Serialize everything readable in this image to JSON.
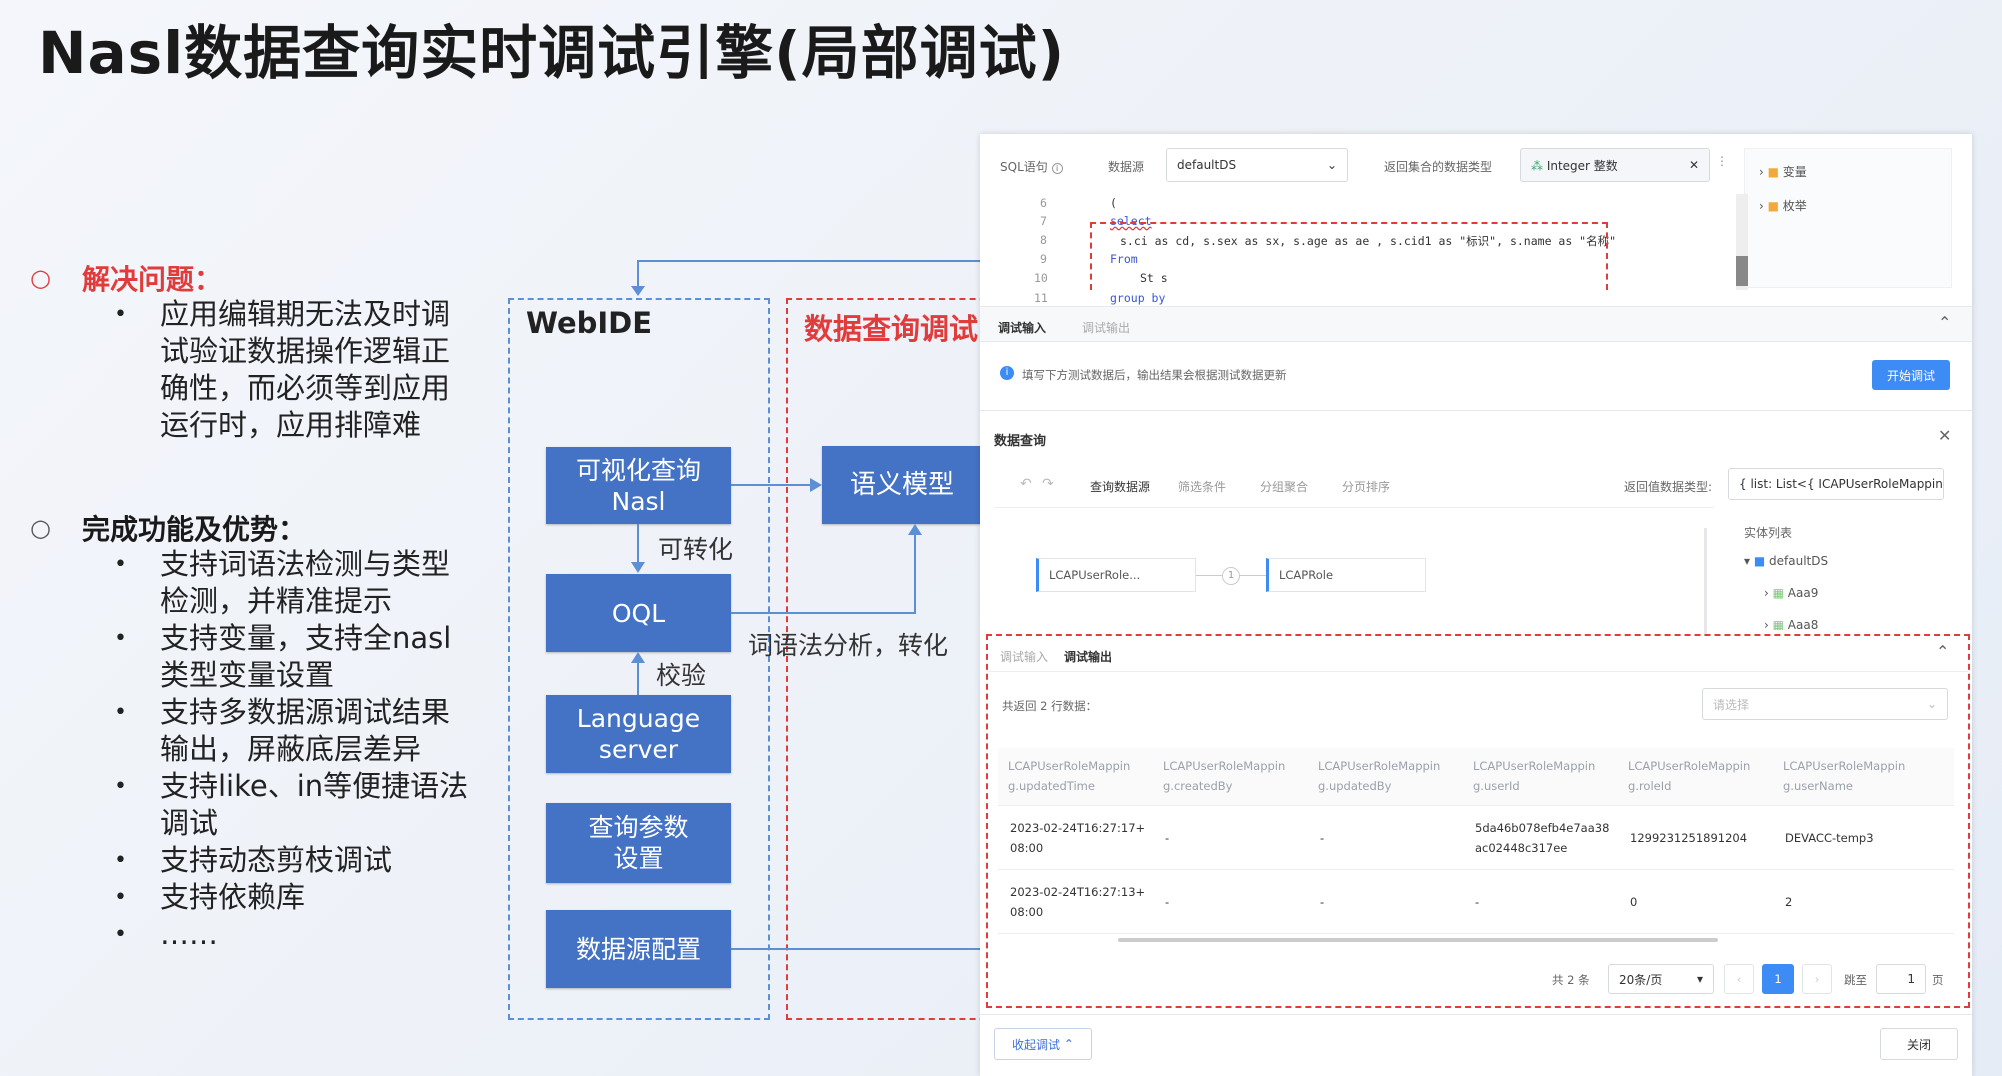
{
  "slide": {
    "title": "Nasl数据查询实时调试引擎(局部调试)",
    "section1": {
      "heading": "解决问题：",
      "bullet_icon": "○",
      "items": [
        "应用编辑期无法及时调试验证数据操作逻辑正确性，而必须等到应用运行时，应用排障难"
      ]
    },
    "section2": {
      "heading": "完成功能及优势：",
      "bullet_icon": "○",
      "items": [
        "支持词语法检测与类型检测，并精准提示",
        "支持变量，支持全nasl类型变量设置",
        "支持多数据源调试结果输出，屏蔽底层差异",
        "支持like、in等便捷语法调试",
        "支持动态剪枝调试",
        "支持依赖库",
        "……"
      ]
    },
    "colors": {
      "accent_red": "#e03c3c",
      "box_blue": "#4472c4",
      "dash_blue": "#5b8fd6"
    }
  },
  "diagram": {
    "webide_label": "WebIDE",
    "debug_label": "数据查询调试",
    "boxes": {
      "visual_query": [
        "可视化查询",
        "Nasl"
      ],
      "oql": "OQL",
      "language_server": [
        "Language",
        "server"
      ],
      "query_params": [
        "查询参数",
        "设置"
      ],
      "datasource_config": "数据源配置",
      "semantic_model": "语义模型"
    },
    "labels": {
      "convertible": "可转化",
      "verify": "校验",
      "lexical_analysis": "词语法分析，转化"
    }
  },
  "ui": {
    "sql_label": "SQL语句",
    "datasource_label": "数据源",
    "datasource_value": "defaultDS",
    "return_type_label": "返回集合的数据类型",
    "return_type_value": "Integer 整数",
    "tree": [
      {
        "label": "变量"
      },
      {
        "label": "枚举"
      }
    ],
    "code_lines": [
      {
        "n": "6",
        "text": "("
      },
      {
        "n": "7",
        "text": "select"
      },
      {
        "n": "8",
        "text": "s.ci as cd, s.sex as sx, s.age as ae , s.cid1 as \"标识\", s.name as \"名称\""
      },
      {
        "n": "9",
        "text": "From"
      },
      {
        "n": "10",
        "text": "St s"
      },
      {
        "n": "11",
        "text": "group by"
      }
    ],
    "top_tabs": [
      "调试输入",
      "调试输出"
    ],
    "info_text": "填写下方测试数据后，输出结果会根据测试数据更新",
    "start_debug": "开始调试",
    "data_query_title": "数据查询",
    "query_tabs": [
      "查询数据源",
      "筛选条件",
      "分组聚合",
      "分页排序"
    ],
    "return_value_type_label": "返回值数据类型:",
    "return_value_type_value": "{ list: List<{ ICAPUserRoleMapping:",
    "entity_list_label": "实体列表",
    "entity_tree": [
      "defaultDS",
      "Aaa9",
      "Aaa8"
    ],
    "join_nodes": [
      "LCAPUserRole...",
      "LCAPRole"
    ],
    "join_index": "1",
    "bottom_tabs": [
      "调试输入",
      "调试输出"
    ],
    "result_count": "共返回 2 行数据：",
    "select_placeholder": "请选择",
    "table": {
      "headers": [
        [
          "LCAPUserRoleMappin",
          "g.updatedTime"
        ],
        [
          "LCAPUserRoleMappin",
          "g.createdBy"
        ],
        [
          "LCAPUserRoleMappin",
          "g.updatedBy"
        ],
        [
          "LCAPUserRoleMappin",
          "g.userId"
        ],
        [
          "LCAPUserRoleMappin",
          "g.roleId"
        ],
        [
          "LCAPUserRoleMappin",
          "g.userName"
        ]
      ],
      "rows": [
        [
          [
            "2023-02-24T16:27:17+",
            "08:00"
          ],
          [
            "-"
          ],
          [
            "-"
          ],
          [
            "5da46b078efb4e7aa38",
            "ac02448c317ee"
          ],
          [
            "1299231251891204"
          ],
          [
            "DEVACC-temp3"
          ]
        ],
        [
          [
            "2023-02-24T16:27:13+",
            "08:00"
          ],
          [
            "-"
          ],
          [
            "-"
          ],
          [
            "-"
          ],
          [
            "0"
          ],
          [
            "2"
          ]
        ]
      ]
    },
    "pagination": {
      "total": "共 2 条",
      "page_size": "20条/页",
      "current_page": "1",
      "jump_label": "跳至",
      "jump_value": "1",
      "page_unit": "页"
    },
    "collapse_button": "收起调试",
    "close_button": "关闭"
  }
}
